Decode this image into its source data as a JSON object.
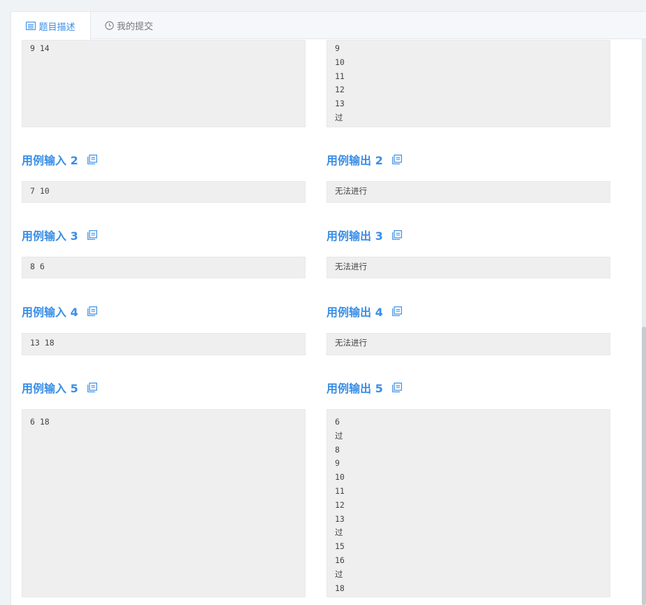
{
  "tabs": {
    "description": "题目描述",
    "submissions": "我的提交"
  },
  "top_input": {
    "lines": [
      "9 14"
    ]
  },
  "top_output": {
    "lines": [
      "9",
      "10",
      "11",
      "12",
      "13",
      "过"
    ]
  },
  "samples": [
    {
      "input_label": "用例输入 2",
      "output_label": "用例输出 2",
      "input": [
        "7 10"
      ],
      "output": [
        "无法进行"
      ]
    },
    {
      "input_label": "用例输入 3",
      "output_label": "用例输出 3",
      "input": [
        "8 6"
      ],
      "output": [
        "无法进行"
      ]
    },
    {
      "input_label": "用例输入 4",
      "output_label": "用例输出 4",
      "input": [
        "13 18"
      ],
      "output": [
        "无法进行"
      ]
    },
    {
      "input_label": "用例输入 5",
      "output_label": "用例输出 5",
      "input": [
        "6 18"
      ],
      "output": [
        "6",
        "过",
        "8",
        "9",
        "10",
        "11",
        "12",
        "13",
        "过",
        "15",
        "16",
        "过",
        "18"
      ]
    }
  ],
  "colors": {
    "accent": "#3a8ee6",
    "box_bg": "#efefef"
  },
  "icons": {
    "description_tab": "list-icon",
    "submissions_tab": "clock-icon",
    "copy": "copy-icon"
  }
}
